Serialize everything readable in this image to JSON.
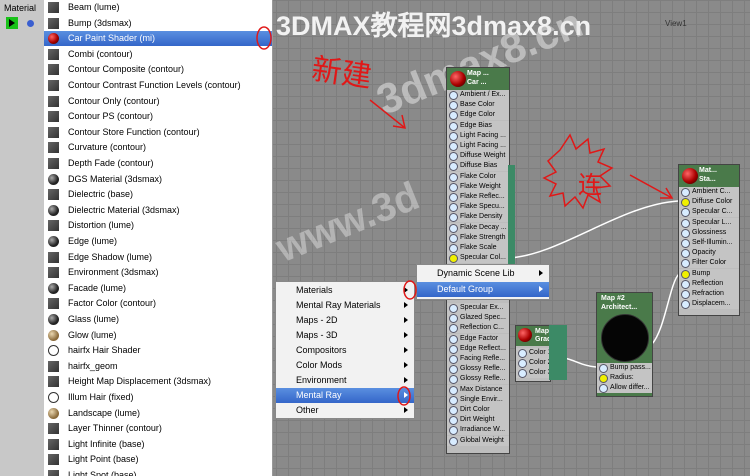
{
  "sidebar": {
    "label": "Material"
  },
  "watermark": {
    "top": "3DMAX教程网3dmax8.cn",
    "diagonal": "3dmax8.cn",
    "diagonal2": "www.3d"
  },
  "viewport": {
    "title": "View1"
  },
  "material_list": [
    {
      "label": "Beam (lume)",
      "icon": "material-swatch-icon"
    },
    {
      "label": "Bump (3dsmax)",
      "icon": "material-swatch-icon"
    },
    {
      "label": "Car Paint Shader (mi)",
      "icon": "red-sphere-icon",
      "selected": true
    },
    {
      "label": "Combi (contour)",
      "icon": "material-swatch-icon"
    },
    {
      "label": "Contour Composite (contour)",
      "icon": "material-swatch-icon"
    },
    {
      "label": "Contour Contrast Function Levels (contour)",
      "icon": "material-swatch-icon"
    },
    {
      "label": "Contour Only (contour)",
      "icon": "material-swatch-icon"
    },
    {
      "label": "Contour PS (contour)",
      "icon": "material-swatch-icon"
    },
    {
      "label": "Contour Store Function (contour)",
      "icon": "material-swatch-icon"
    },
    {
      "label": "Curvature (contour)",
      "icon": "material-swatch-icon"
    },
    {
      "label": "Depth Fade (contour)",
      "icon": "material-swatch-icon"
    },
    {
      "label": "DGS Material (3dsmax)",
      "icon": "dark-sphere-icon"
    },
    {
      "label": "Dielectric (base)",
      "icon": "material-swatch-icon"
    },
    {
      "label": "Dielectric Material (3dsmax)",
      "icon": "dark-sphere-icon"
    },
    {
      "label": "Distortion (lume)",
      "icon": "material-swatch-icon"
    },
    {
      "label": "Edge (lume)",
      "icon": "dark-sphere-icon"
    },
    {
      "label": "Edge Shadow (lume)",
      "icon": "material-swatch-icon"
    },
    {
      "label": "Environment (3dsmax)",
      "icon": "material-swatch-icon"
    },
    {
      "label": "Facade (lume)",
      "icon": "dark-sphere-icon"
    },
    {
      "label": "Factor Color (contour)",
      "icon": "material-swatch-icon"
    },
    {
      "label": "Glass (lume)",
      "icon": "dark-sphere-icon"
    },
    {
      "label": "Glow (lume)",
      "icon": "tan-sphere-icon"
    },
    {
      "label": "hairfx Hair Shader",
      "icon": "white-circle-icon"
    },
    {
      "label": "hairfx_geom",
      "icon": "material-swatch-icon"
    },
    {
      "label": "Height Map Displacement (3dsmax)",
      "icon": "material-swatch-icon"
    },
    {
      "label": "Illum Hair (fixed)",
      "icon": "white-circle-icon"
    },
    {
      "label": "Landscape (lume)",
      "icon": "tan-sphere-icon"
    },
    {
      "label": "Layer Thinner (contour)",
      "icon": "material-swatch-icon"
    },
    {
      "label": "Light Infinite (base)",
      "icon": "material-swatch-icon"
    },
    {
      "label": "Light Point (base)",
      "icon": "material-swatch-icon"
    },
    {
      "label": "Light Spot (base)",
      "icon": "material-swatch-icon"
    }
  ],
  "node_car": {
    "title1": "Map ...",
    "title2": "Car ...",
    "slots_top": [
      "Ambient / Ex...",
      "Base Color",
      "Edge Color",
      "Edge Bias",
      "Light Facing ...",
      "Light Facing ...",
      "Diffuse Weight",
      "Diffuse Bias",
      "Flake Color",
      "Flake Weight",
      "Flake Reflec...",
      "Flake Specu...",
      "Flake Density",
      "Flake Decay ...",
      "Flake Strength",
      "Flake Scale",
      "Specular Col..."
    ],
    "slots_bottom": [
      "Specular Ex...",
      "Glazed Spec...",
      "Reflection C...",
      "Edge Factor",
      "Edge Reflect...",
      "Facing Refle...",
      "Glossy Refle...",
      "Glossy Refle...",
      "Max Distance",
      "Single Envir...",
      "Dirt Color",
      "Dirt Weight",
      "Irradiance W...",
      "Global Weight"
    ]
  },
  "node_std": {
    "title1": "Mat...",
    "title2": "Sta...",
    "slots": [
      "Ambient C...",
      "Diffuse Color",
      "Specular C...",
      "Specular L...",
      "Glossiness",
      "Self-Illumin...",
      "Opacity",
      "Filter Color",
      "Bump",
      "Reflection",
      "Refraction",
      "Displacem..."
    ]
  },
  "node_grad": {
    "title1": "Map #8",
    "title2": "Gradi...",
    "slots": [
      "Color 1",
      "Color 2",
      "Color 3"
    ]
  },
  "node_arch": {
    "title1": "Map #2",
    "title2": "Architect...",
    "slots": [
      "Bump pass...",
      "Radius:",
      "Allow differ..."
    ]
  },
  "context_menu": [
    {
      "label": "Materials",
      "sub": true
    },
    {
      "label": "Mental Ray Materials",
      "sub": true
    },
    {
      "label": "Maps - 2D",
      "sub": true
    },
    {
      "label": "Maps - 3D",
      "sub": true
    },
    {
      "label": "Compositors",
      "sub": true
    },
    {
      "label": "Color Mods",
      "sub": true
    },
    {
      "label": "Environment",
      "sub": true
    },
    {
      "label": "Mental Ray",
      "sub": true,
      "selected": true
    },
    {
      "label": "Other",
      "sub": true
    }
  ],
  "submenu": [
    {
      "label": "Dynamic Scene Lib",
      "sub": true
    },
    {
      "label": "Default Group",
      "sub": true,
      "selected": true
    }
  ],
  "annotations": {
    "new": "新建",
    "connect": "连"
  },
  "colors": {
    "selection": "#3a6fd0",
    "node_header": "#4a7a4a",
    "annotation": "#e01818",
    "wire": "#ffffff"
  }
}
